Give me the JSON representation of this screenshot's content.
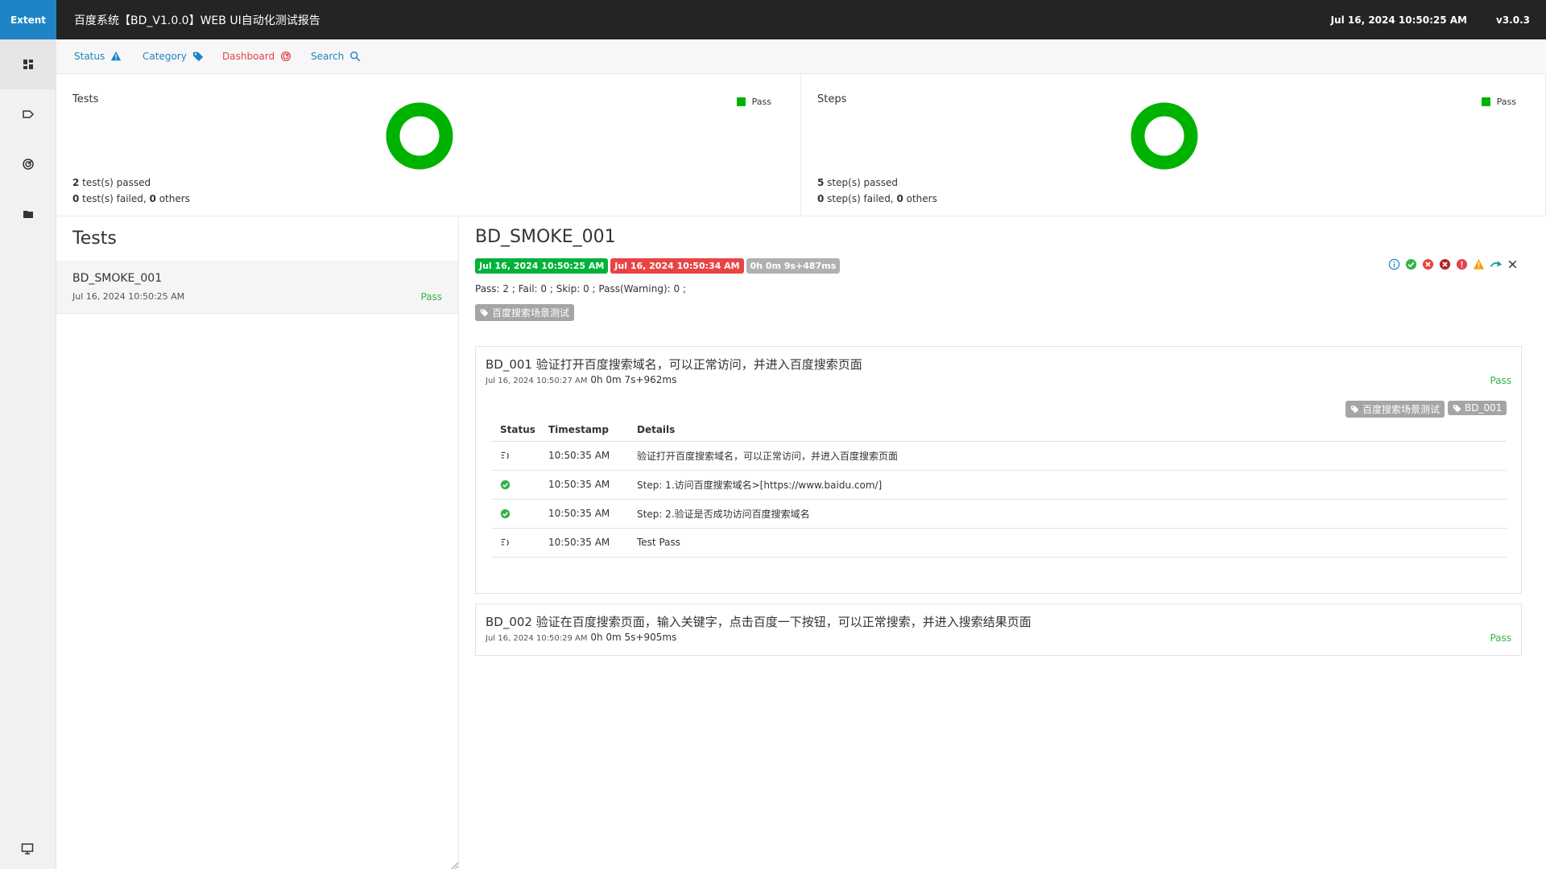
{
  "header": {
    "brand": "Extent",
    "title": "百度系统【BD_V1.0.0】WEB UI自动化测试报告",
    "date": "Jul 16, 2024 10:50:25 AM",
    "version": "v3.0.3"
  },
  "sidebar": {
    "items": [
      {
        "icon": "dashboard-icon"
      },
      {
        "icon": "tag-icon"
      },
      {
        "icon": "dashboard-gauge-icon"
      },
      {
        "icon": "folder-icon"
      }
    ],
    "bottom_icon": "monitor-icon"
  },
  "nav": {
    "status": "Status",
    "category": "Category",
    "dashboard": "Dashboard",
    "search": "Search"
  },
  "dashboard": {
    "tests": {
      "title": "Tests",
      "legend": "Pass",
      "passed_count": "2",
      "passed_text": " test(s) passed",
      "failed_count": "0",
      "failed_text": " test(s) failed, ",
      "others_count": "0",
      "others_text": " others",
      "pass_fraction": 1.0
    },
    "steps": {
      "title": "Steps",
      "legend": "Pass",
      "passed_count": "5",
      "passed_text": " step(s) passed",
      "failed_count": "0",
      "failed_text": " step(s) failed, ",
      "others_count": "0",
      "others_text": " others",
      "pass_fraction": 1.0
    }
  },
  "test_list": {
    "heading": "Tests",
    "items": [
      {
        "name": "BD_SMOKE_001",
        "time": "Jul 16, 2024 10:50:25 AM",
        "status": "Pass"
      }
    ]
  },
  "detail": {
    "title": "BD_SMOKE_001",
    "start": "Jul 16, 2024 10:50:25 AM",
    "end": "Jul 16, 2024 10:50:34 AM",
    "duration": "0h 0m 9s+487ms",
    "counts": "Pass: 2 ; Fail: 0 ; Skip: 0 ; Pass(Warning): 0 ;",
    "category": "百度搜索场景测试",
    "nodes": [
      {
        "title": "BD_001 验证打开百度搜索域名，可以正常访问，并进入百度搜索页面",
        "timestamp": "Jul 16, 2024 10:50:27 AM",
        "duration": "0h 0m 7s+962ms",
        "status": "Pass",
        "tags": [
          "百度搜索场景测试",
          "BD_001"
        ],
        "columns": [
          "Status",
          "Timestamp",
          "Details"
        ],
        "rows": [
          {
            "status": "info",
            "time": "10:50:35 AM",
            "details": "验证打开百度搜索域名，可以正常访问，并进入百度搜索页面"
          },
          {
            "status": "pass",
            "time": "10:50:35 AM",
            "details": "Step: 1.访问百度搜索域名>[https://www.baidu.com/]"
          },
          {
            "status": "pass",
            "time": "10:50:35 AM",
            "details": "Step: 2.验证是否成功访问百度搜索域名"
          },
          {
            "status": "info",
            "time": "10:50:35 AM",
            "details": "Test Pass"
          }
        ]
      },
      {
        "title": "BD_002 验证在百度搜索页面，输入关键字，点击百度一下按钮，可以正常搜索，并进入搜索结果页面",
        "timestamp": "Jul 16, 2024 10:50:29 AM",
        "duration": "0h 0m 5s+905ms",
        "status": "Pass"
      }
    ]
  },
  "colors": {
    "brand": "#1d84c6",
    "pass": "#00b200",
    "fail": "#e84444",
    "link": "#1d84c6",
    "dashboard_link": "#e5414a"
  }
}
